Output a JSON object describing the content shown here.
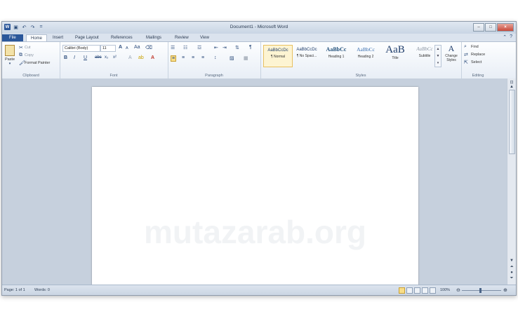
{
  "window": {
    "title": "Document1 - Microsoft Word"
  },
  "qat": {
    "word_icon": "W",
    "save_icon": "floppy-disk",
    "undo_icon": "undo-arrow",
    "redo_icon": "redo-arrow",
    "customize_icon": "="
  },
  "window_buttons": {
    "minimize": "–",
    "maximize": "□",
    "close": "×"
  },
  "tabs": [
    {
      "label": "File"
    },
    {
      "label": "Home"
    },
    {
      "label": "Insert"
    },
    {
      "label": "Page Layout"
    },
    {
      "label": "References"
    },
    {
      "label": "Mailings"
    },
    {
      "label": "Review"
    },
    {
      "label": "View"
    }
  ],
  "ribbon": {
    "clipboard": {
      "paste": "Paste",
      "cut": "Cut",
      "copy": "Copy",
      "format_painter": "Format Painter",
      "label": "Clipboard"
    },
    "font": {
      "name": "Calibri (Body)",
      "size": "11",
      "grow": "A",
      "shrink": "A",
      "change_case": "Aa",
      "bold": "B",
      "italic": "I",
      "underline": "U",
      "strike": "abc",
      "subscript": "x₂",
      "superscript": "x²",
      "label": "Font"
    },
    "paragraph": {
      "label": "Paragraph",
      "show_marks": "¶"
    },
    "styles": {
      "items": [
        {
          "preview": "AaBbCcDc",
          "name": "¶ Normal"
        },
        {
          "preview": "AaBbCcDc",
          "name": "¶ No Spaci..."
        },
        {
          "preview": "AaBbCc",
          "name": "Heading 1"
        },
        {
          "preview": "AaBbCc",
          "name": "Heading 2"
        },
        {
          "preview": "AaB",
          "name": "Title"
        },
        {
          "preview": "AaBbCc",
          "name": "Subtitle"
        }
      ],
      "change_styles": "Change Styles",
      "label": "Styles"
    },
    "editing": {
      "find": "Find",
      "replace": "Replace",
      "select": "Select",
      "label": "Editing"
    }
  },
  "document": {
    "watermark": "mutazarab.org"
  },
  "statusbar": {
    "page": "Page: 1 of 1",
    "words": "Words: 0",
    "zoom": "100%",
    "zoom_level": 1.0
  }
}
